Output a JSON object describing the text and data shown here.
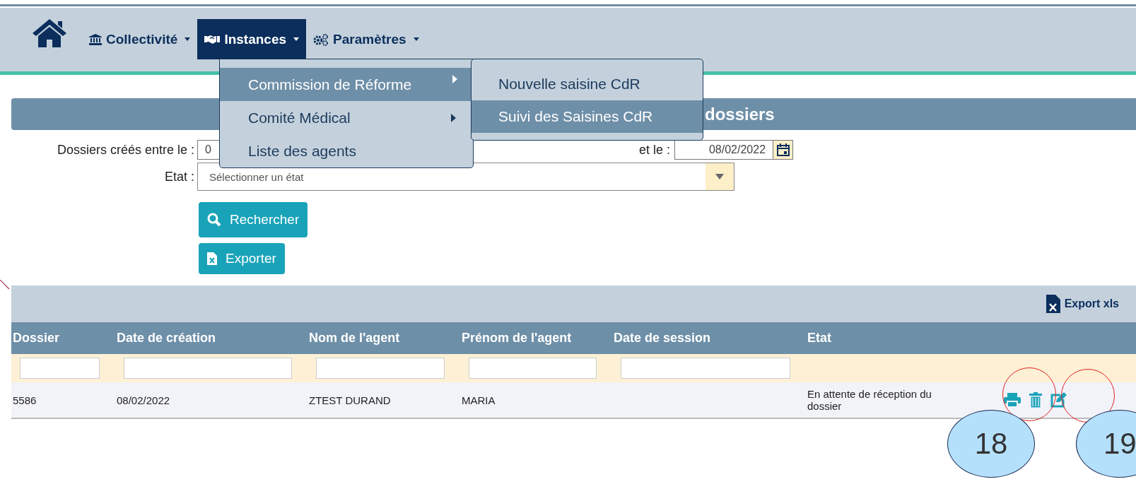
{
  "nav": {
    "items": [
      {
        "label": "Collectivité",
        "selected": false
      },
      {
        "label": "Instances",
        "selected": true
      },
      {
        "label": "Paramètres",
        "selected": false
      }
    ]
  },
  "menu": {
    "items": [
      {
        "label": "Commission de Réforme",
        "selected": true,
        "has_submenu": true
      },
      {
        "label": "Comité Médical",
        "selected": false,
        "has_submenu": true
      },
      {
        "label": "Liste des agents",
        "selected": false,
        "has_submenu": false
      }
    ],
    "submenu": [
      {
        "label": "Nouvelle saisine CdR",
        "selected": false
      },
      {
        "label": "Suivi des Saisines CdR",
        "selected": true
      }
    ]
  },
  "page_title": "dossiers",
  "filters": {
    "created_between_label": "Dossiers créés entre le :",
    "date_from": "0",
    "and_label": "et le :",
    "date_to": "08/02/2022",
    "state_label": "Etat :",
    "state_placeholder": "Sélectionner un état"
  },
  "buttons": {
    "search": "Rechercher",
    "export": "Exporter"
  },
  "table": {
    "export_link": "Export xls",
    "columns": [
      "Dossier",
      "Date de création",
      "Nom de l'agent",
      "Prénom de l'agent",
      "Date de session",
      "Etat"
    ],
    "filter_columns": [
      true,
      true,
      true,
      true,
      true,
      false
    ],
    "rows": [
      {
        "cells": [
          "5586",
          "08/02/2022",
          "ZTEST DURAND",
          "MARIA",
          "",
          "En attente de réception du dossier"
        ]
      }
    ]
  },
  "annotations": [
    "18",
    "19"
  ]
}
